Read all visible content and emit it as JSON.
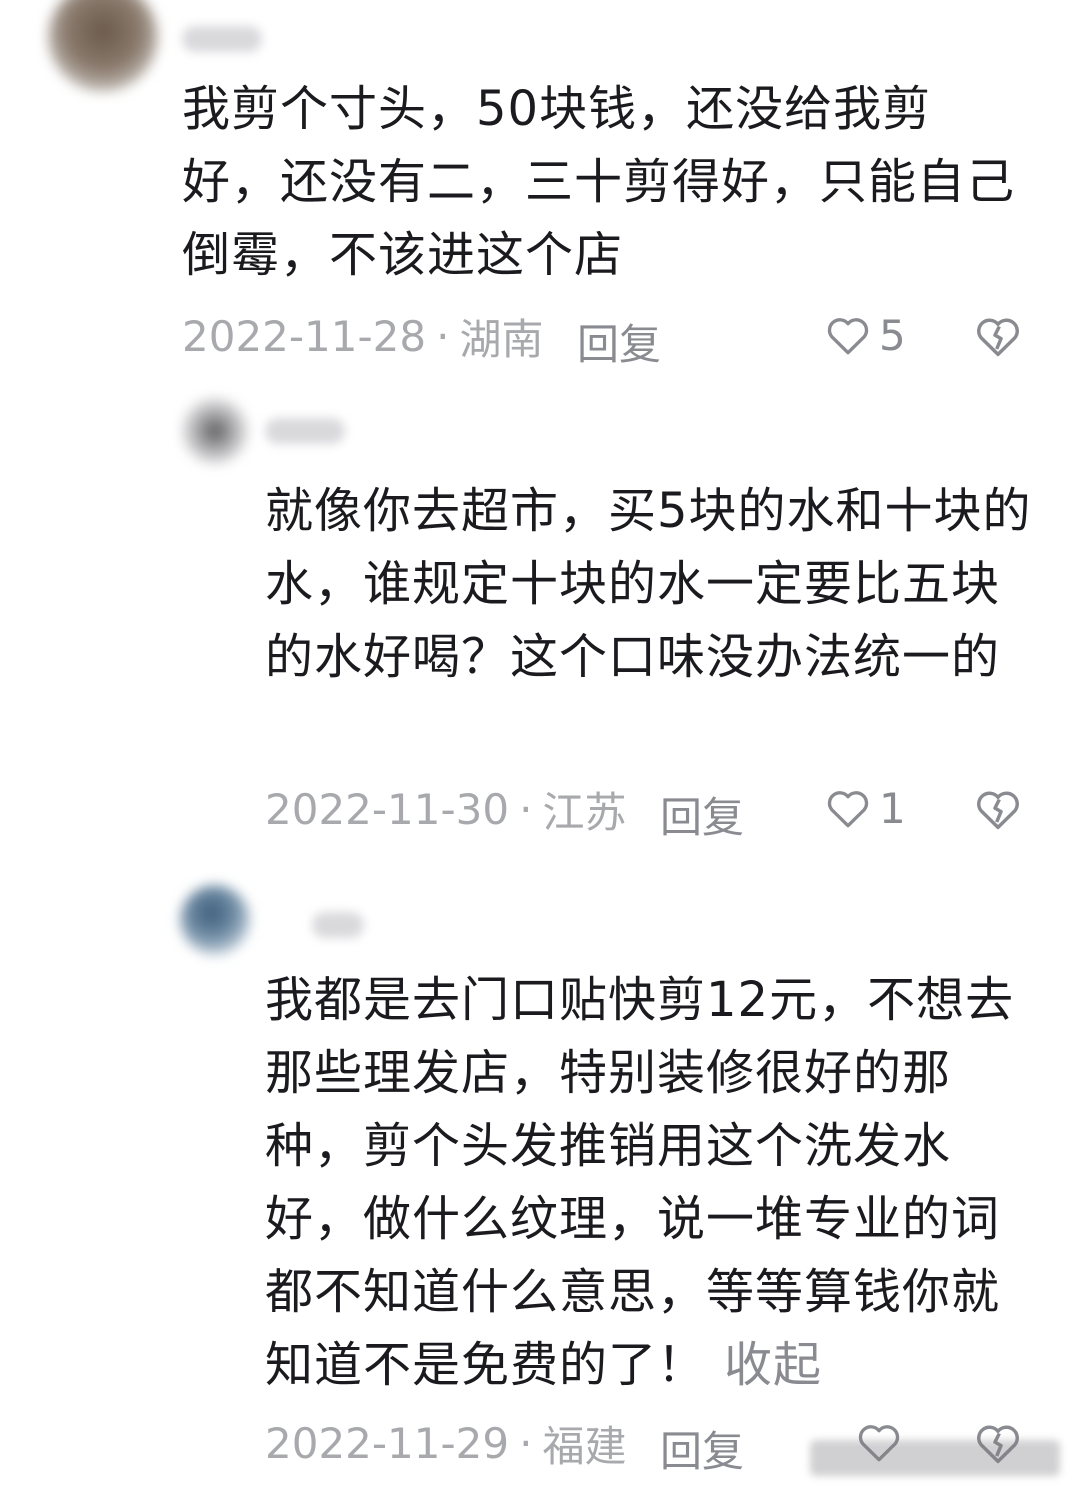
{
  "comments": [
    {
      "text": "我剪个寸头，50块钱，还没给我剪好，还没有二，三十剪得好，只能自己倒霉，不该进这个店",
      "date": "2022-11-28",
      "separator": "·",
      "region": "湖南",
      "reply_label": "回复",
      "like_count": "5"
    },
    {
      "text": "就像你去超市，买5块的水和十块的水，谁规定十块的水一定要比五块的水好喝？这个口味没办法统一的",
      "date": "2022-11-30",
      "separator": "·",
      "region": "江苏",
      "reply_label": "回复",
      "like_count": "1"
    },
    {
      "text": "我都是去门口贴快剪12元，不想去那些理发店，特别装修很好的那种，剪个头发推销用这个洗发水好，做什么纹理，说一堆专业的词都不知道什么意思，等等算钱你就知道不是免费的了！",
      "collapse_label": "收起",
      "date": "2022-11-29",
      "separator": "·",
      "region": "福建",
      "reply_label": "回复"
    }
  ],
  "icons": {
    "like": "heart-outline-icon",
    "dislike": "broken-heart-icon"
  },
  "colors": {
    "text": "#1a1a1f",
    "meta": "#a8a9ad",
    "action": "#8a8b91"
  }
}
